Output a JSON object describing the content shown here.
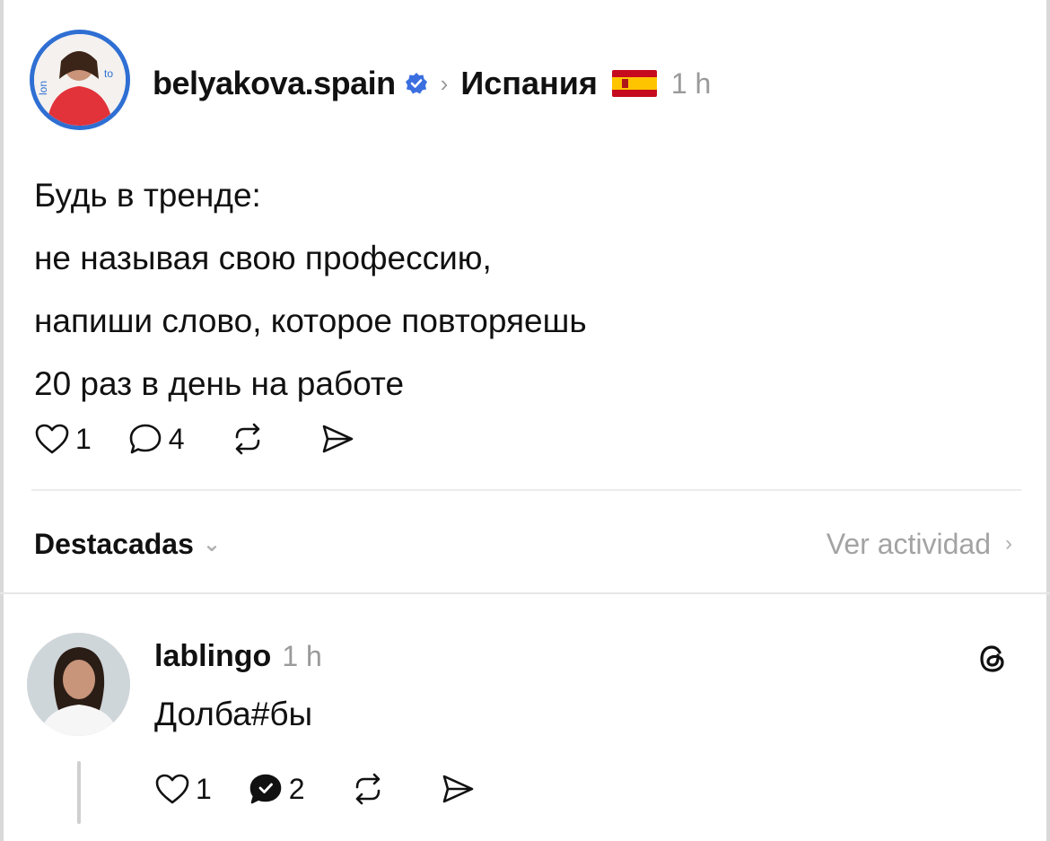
{
  "post": {
    "username": "belyakova.spain",
    "location": "Испания",
    "time": "1 h",
    "text_lines": [
      "Будь в тренде:",
      "не называя свою профессию,",
      "напиши слово, которое повторяешь",
      "20 раз в день на работе"
    ],
    "likes": "1",
    "comments": "4"
  },
  "filter": {
    "label": "Destacadas",
    "activity_label": "Ver actividad"
  },
  "reply": {
    "username": "lablingo",
    "time": "1 h",
    "text": "Долба#бы",
    "likes": "1",
    "comments": "2"
  },
  "icons": {
    "verified": "verified-badge-icon",
    "flag": "spain-flag-icon",
    "like": "heart-icon",
    "comment": "comment-bubble-icon",
    "repost": "repost-icon",
    "share": "send-icon",
    "threads": "threads-logo-icon"
  },
  "colors": {
    "verified_blue": "#3b6fe0",
    "muted_gray": "#9a9a9a",
    "avatar_ring": "#2f6fd3"
  }
}
